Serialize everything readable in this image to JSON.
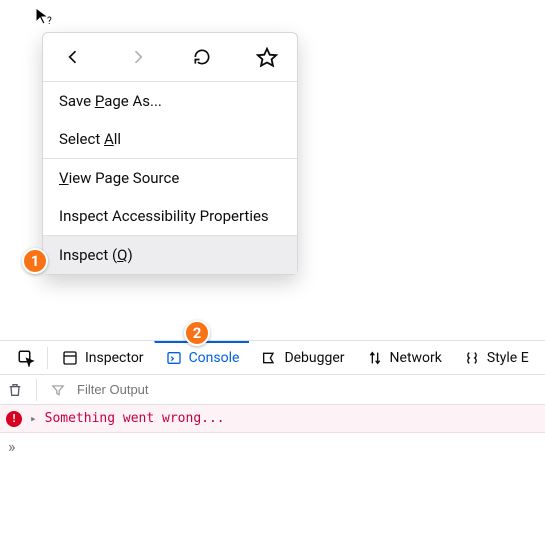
{
  "cursor": {
    "title": "pointer-help"
  },
  "contextMenu": {
    "nav": {
      "back": "back-icon",
      "forward": "forward-icon",
      "reload": "reload-icon",
      "bookmark": "star-icon"
    },
    "items": [
      {
        "prefix": "Save ",
        "u": "P",
        "suffix": "age As..."
      },
      {
        "prefix": "Select ",
        "u": "A",
        "suffix": "ll"
      },
      {
        "prefix": "",
        "u": "V",
        "suffix": "iew Page Source"
      },
      {
        "prefix": "Inspect Accessibility Properties",
        "u": "",
        "suffix": ""
      },
      {
        "prefix": "Inspect (",
        "u": "Q",
        "suffix": ")"
      }
    ]
  },
  "badges": {
    "one": "1",
    "two": "2"
  },
  "devtools": {
    "tabs": {
      "picker": "element-picker-icon",
      "inspector": "Inspector",
      "console": "Console",
      "debugger": "Debugger",
      "network": "Network",
      "style": "Style E"
    },
    "filter": {
      "trash": "trash-icon",
      "funnel": "funnel-icon",
      "placeholder": "Filter Output"
    },
    "error": {
      "caret": "▸",
      "message": "Something went wrong..."
    },
    "prompt": "»"
  }
}
